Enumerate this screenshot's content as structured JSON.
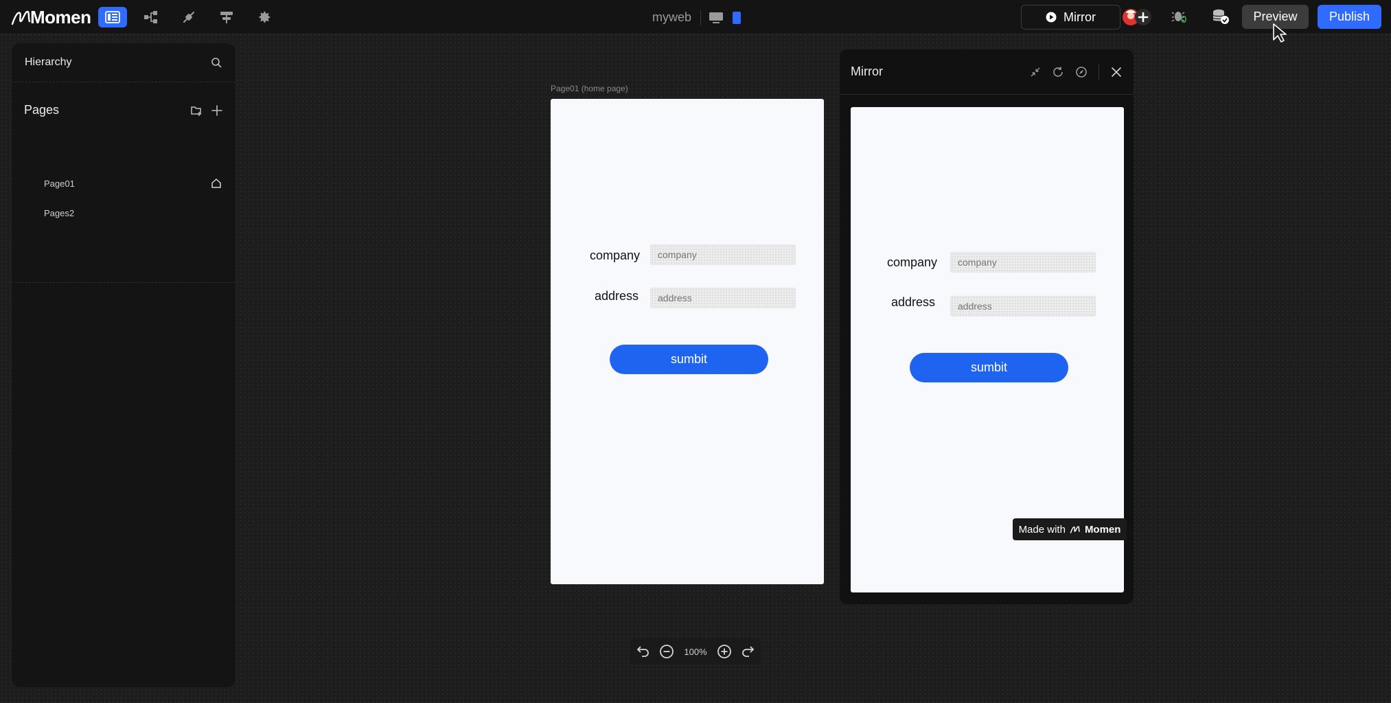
{
  "app": {
    "brand": "Momen",
    "project_name": "myweb"
  },
  "toolbar": {
    "mirror_label": "Mirror",
    "preview_label": "Preview",
    "publish_label": "Publish",
    "debug_count": "0"
  },
  "hierarchy": {
    "title": "Hierarchy",
    "pages_title": "Pages",
    "pages": [
      {
        "label": "Page01",
        "home": true
      },
      {
        "label": "Pages2",
        "home": false
      }
    ]
  },
  "canvas": {
    "frame_label": "Page01 (home page)",
    "zoom": "100%"
  },
  "form": {
    "company_label": "company",
    "company_placeholder": "company",
    "address_label": "address",
    "address_placeholder": "address",
    "submit_label": "sumbit"
  },
  "mirror": {
    "title": "Mirror",
    "made_with": "Made with",
    "made_with_brand": "Momen"
  },
  "colors": {
    "accent": "#2f6bff",
    "button": "#1f64f0",
    "panel": "#141414",
    "debug_count": "#34c759"
  }
}
